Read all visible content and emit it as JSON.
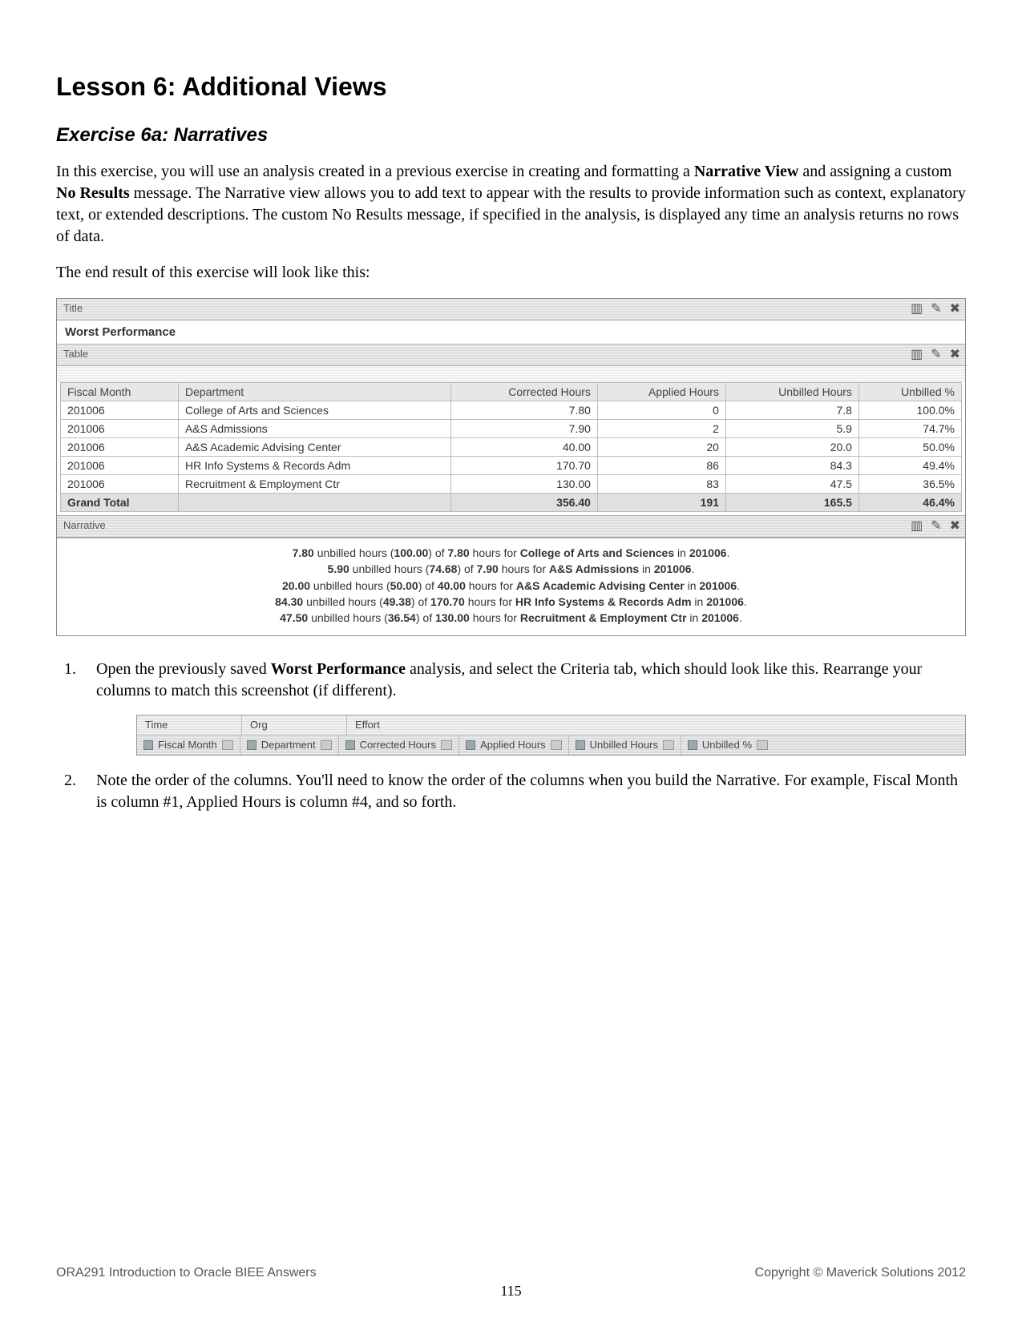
{
  "heading": "Lesson 6: Additional Views",
  "exercise_title": "Exercise 6a: Narratives",
  "para1_a": "In this exercise, you will use an analysis created in a previous exercise in creating and formatting a ",
  "para1_b1": "Narrative View",
  "para1_c": " and assigning a custom ",
  "para1_b2": "No Results",
  "para1_d": " message. The Narrative view allows you to add text to appear with the results to provide information such as context, explanatory text, or extended descriptions.  The custom No Results message, if specified in the analysis, is displayed any time an analysis returns no rows of data.",
  "para2": "The end result of this exercise will look like this:",
  "views": {
    "title_hdr": "Title",
    "title_text": "Worst Performance",
    "table_hdr": "Table",
    "narrative_hdr": "Narrative"
  },
  "table": {
    "headers": [
      "Fiscal Month",
      "Department",
      "Corrected Hours",
      "Applied Hours",
      "Unbilled Hours",
      "Unbilled %"
    ],
    "rows": [
      [
        "201006",
        "College of Arts and Sciences",
        "7.80",
        "0",
        "7.8",
        "100.0%"
      ],
      [
        "201006",
        "A&S Admissions",
        "7.90",
        "2",
        "5.9",
        "74.7%"
      ],
      [
        "201006",
        "A&S Academic Advising Center",
        "40.00",
        "20",
        "20.0",
        "50.0%"
      ],
      [
        "201006",
        "HR Info Systems & Records Adm",
        "170.70",
        "86",
        "84.3",
        "49.4%"
      ],
      [
        "201006",
        "Recruitment & Employment Ctr",
        "130.00",
        "83",
        "47.5",
        "36.5%"
      ]
    ],
    "total": [
      "Grand Total",
      "",
      "356.40",
      "191",
      "165.5",
      "46.4%"
    ]
  },
  "narr": [
    {
      "u": "7.80",
      "p": "100.00",
      "t": "7.80",
      "d": "College of Arts and Sciences",
      "m": "201006"
    },
    {
      "u": "5.90",
      "p": "74.68",
      "t": "7.90",
      "d": "A&S Admissions",
      "m": "201006"
    },
    {
      "u": "20.00",
      "p": "50.00",
      "t": "40.00",
      "d": "A&S Academic Advising Center",
      "m": "201006"
    },
    {
      "u": "84.30",
      "p": "49.38",
      "t": "170.70",
      "d": "HR Info Systems & Records Adm",
      "m": "201006"
    },
    {
      "u": "47.50",
      "p": "36.54",
      "t": "130.00",
      "d": "Recruitment & Employment Ctr",
      "m": "201006"
    }
  ],
  "step1_a": "Open the previously saved ",
  "step1_b": "Worst Performance",
  "step1_c": " analysis, and select the Criteria tab, which should look like this.  Rearrange your columns to match this screenshot (if different).",
  "criteria": {
    "groups": [
      "Time",
      "Org",
      "Effort"
    ],
    "cols": [
      "Fiscal Month",
      "Department",
      "Corrected Hours",
      "Applied Hours",
      "Unbilled Hours",
      "Unbilled %"
    ]
  },
  "step2": "Note the order of the columns.  You'll need to know the order of the columns when you build the Narrative.  For example, Fiscal Month is column #1, Applied Hours is column #4, and so forth.",
  "footer_left": "ORA291 Introduction to Oracle BIEE Answers",
  "footer_right": "Copyright © Maverick Solutions 2012",
  "page_number": "115"
}
